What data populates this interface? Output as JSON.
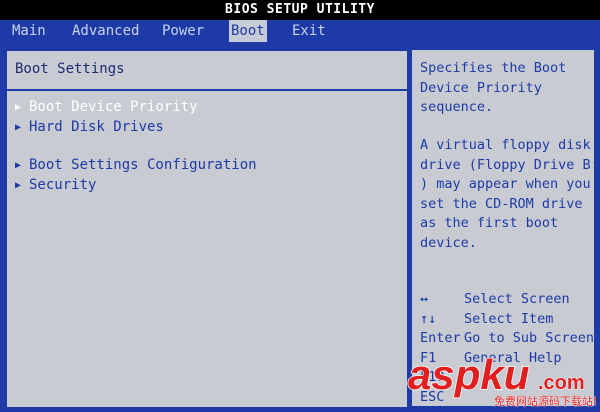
{
  "title": "BIOS SETUP UTILITY",
  "tabs": [
    {
      "label": "Main"
    },
    {
      "label": "Advanced"
    },
    {
      "label": "Power"
    },
    {
      "label": "Boot"
    },
    {
      "label": "Exit"
    }
  ],
  "active_tab": "Boot",
  "main": {
    "section_title": "Boot Settings",
    "items": [
      {
        "label": "Boot Device Priority",
        "selected": true
      },
      {
        "label": "Hard Disk Drives",
        "selected": false
      },
      {
        "label": "Boot Settings Configuration",
        "selected": false
      },
      {
        "label": "Security",
        "selected": false
      }
    ]
  },
  "help": {
    "paragraph1": "Specifies the Boot\nDevice Priority\nsequence.",
    "paragraph2": "A virtual floppy disk\ndrive (Floppy Drive B:\n) may appear when you\nset the CD-ROM drive\nas the first boot\ndevice.",
    "keys": [
      {
        "key": "↔",
        "action": "Select Screen"
      },
      {
        "key": "↑↓",
        "action": "Select Item"
      },
      {
        "key": "Enter",
        "action": "Go to Sub Screen"
      },
      {
        "key": "F1",
        "action": "General Help"
      },
      {
        "key": "F10",
        "action": ""
      },
      {
        "key": "ESC",
        "action": ""
      }
    ]
  },
  "watermark": {
    "logo": "aspku",
    "suffix": ".com",
    "tagline": "免费网站源码下载站!"
  },
  "colors": {
    "bios_blue": "#1d3aa6",
    "panel_gray": "#c8cbd2",
    "watermark_red": "#e02020"
  }
}
